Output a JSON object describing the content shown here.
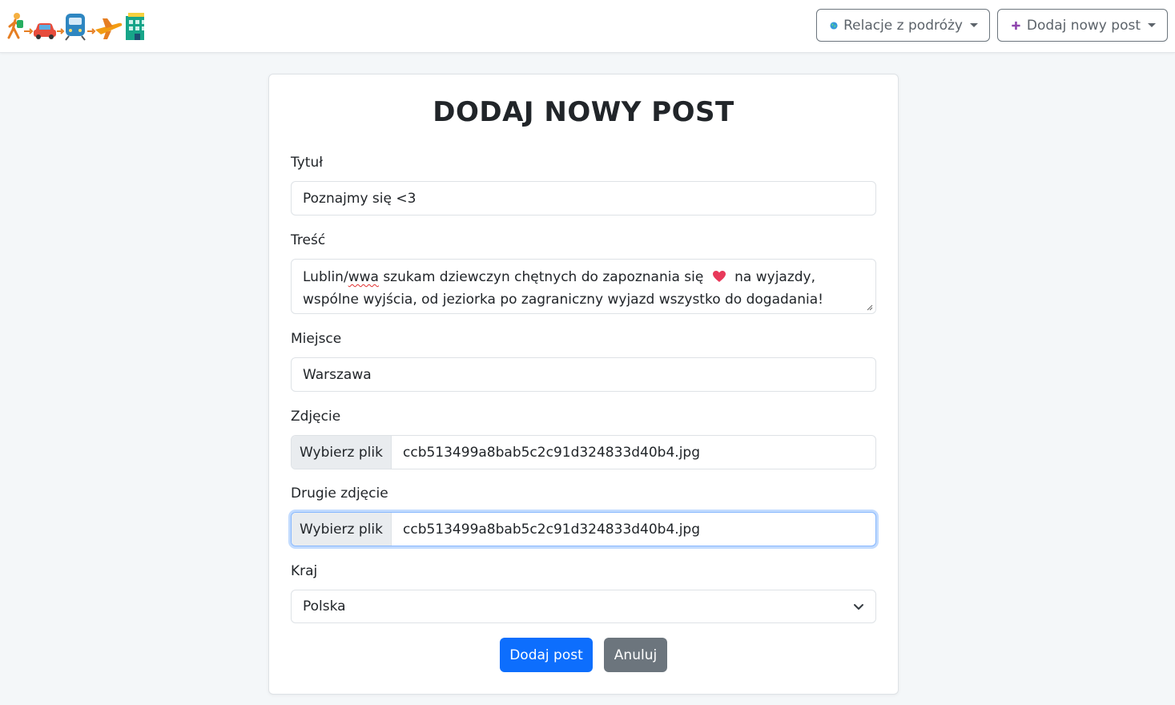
{
  "navbar": {
    "logo_icon": "travel-emoji-logo",
    "travel_dropdown": {
      "label": "Relacje z podróży",
      "icon": "globe-icon"
    },
    "add_dropdown": {
      "label": "Dodaj nowy post",
      "icon": "plus-icon"
    }
  },
  "form": {
    "title": "DODAJ NOWY POST",
    "title_label": "Tytuł",
    "title_value": "Poznajmy się <3",
    "content_label": "Treść",
    "content_before": "Lublin/",
    "content_underlined": "wwa",
    "content_after_word": " szukam dziewczyn chętnych do zapoznania się",
    "content_after_heart": "na wyjazdy, wspólne wyjścia, od jeziorka po zagraniczny wyjazd wszystko do dogadania!",
    "place_label": "Miejsce",
    "place_value": "Warszawa",
    "photo_label": "Zdjęcie",
    "photo_button": "Wybierz plik",
    "photo_file": "ccb513499a8bab5c2c91d324833d40b4.jpg",
    "photo2_label": "Drugie zdjęcie",
    "photo2_button": "Wybierz plik",
    "photo2_file": "ccb513499a8bab5c2c91d324833d40b4.jpg",
    "country_label": "Kraj",
    "country_value": "Polska",
    "submit_label": "Dodaj post",
    "cancel_label": "Anuluj"
  },
  "colors": {
    "primary": "#0d6efd",
    "secondary": "#6c757d",
    "background": "#f4f7f9",
    "focus": "#86b7fe"
  }
}
